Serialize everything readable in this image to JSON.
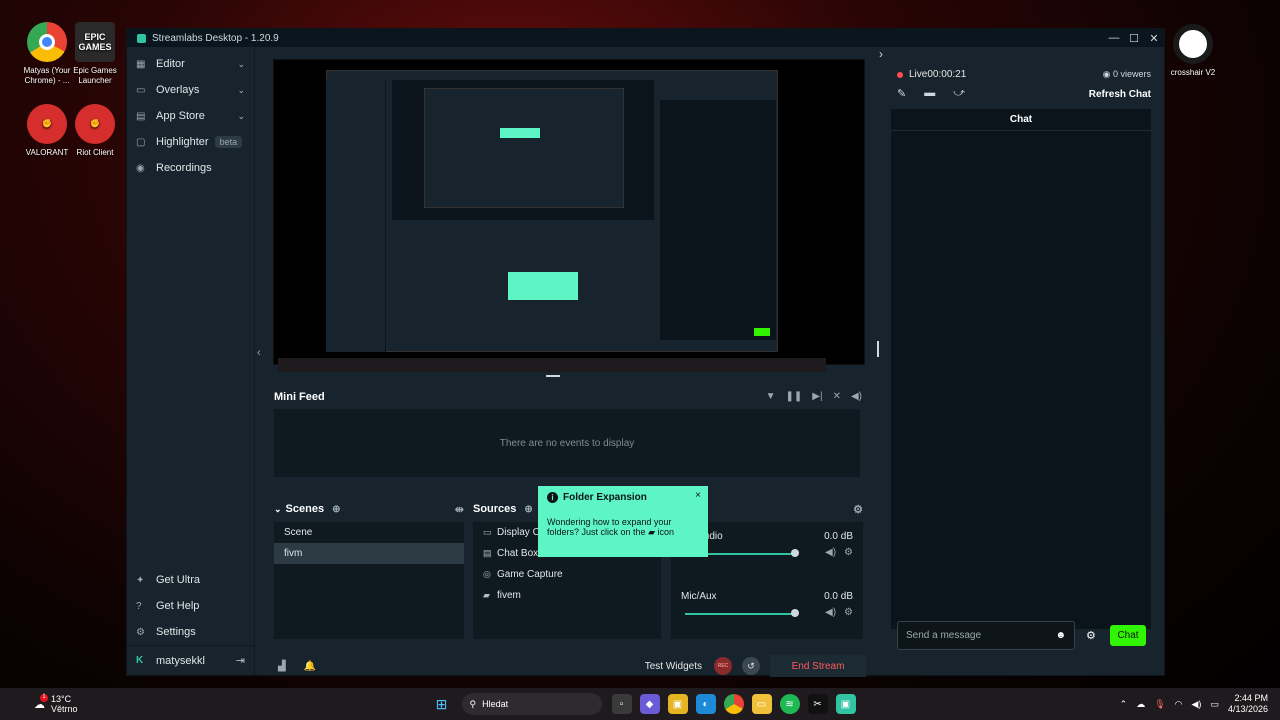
{
  "desktop": {
    "icons": [
      {
        "label": "Matyas (Your Chrome) - ...",
        "color": "#e8453c"
      },
      {
        "label": "Epic Games Launcher",
        "color": "#2a2a2a",
        "badge": "EPIC GAMES"
      },
      {
        "label": "VALORANT",
        "color": "#d62d2d"
      },
      {
        "label": "Riot Client",
        "color": "#d62d2d"
      },
      {
        "label": "crosshair V2",
        "color": "#1a1a1a"
      }
    ]
  },
  "window": {
    "title": "Streamlabs Desktop - 1.20.9",
    "ctrls": [
      "—",
      "☐",
      "✕"
    ]
  },
  "sidebar": {
    "items": [
      {
        "label": "Editor",
        "icon": "layout-icon",
        "glyph": "▦"
      },
      {
        "label": "Overlays",
        "icon": "overlays-icon",
        "glyph": "▭"
      },
      {
        "label": "App Store",
        "icon": "store-icon",
        "glyph": "▤"
      },
      {
        "label": "Highlighter",
        "icon": "highlighter-icon",
        "glyph": "▢",
        "badge": "beta"
      },
      {
        "label": "Recordings",
        "icon": "recordings-icon",
        "glyph": "◉"
      }
    ],
    "bottom": [
      {
        "label": "Get Ultra",
        "icon": "ultra-icon",
        "glyph": "✦"
      },
      {
        "label": "Get Help",
        "icon": "help-icon",
        "glyph": "?"
      },
      {
        "label": "Settings",
        "icon": "gear-icon",
        "glyph": "⚙"
      }
    ],
    "user": "matysekkl"
  },
  "minifeed": {
    "title": "Mini Feed",
    "empty_text": "There are no events to display"
  },
  "scenes": {
    "title": "Scenes",
    "items": [
      "Scene",
      "fivm"
    ]
  },
  "sources": {
    "title": "Sources",
    "items": [
      {
        "label": "Display Ca",
        "glyph": "▭"
      },
      {
        "label": "Chat Box",
        "glyph": "▤"
      },
      {
        "label": "Game Capture",
        "glyph": "◎"
      },
      {
        "label": "fivem",
        "glyph": "▰"
      }
    ]
  },
  "mixer": {
    "channels": [
      {
        "name": "top Audio",
        "value": "0.0 dB"
      },
      {
        "name": "Mic/Aux",
        "value": "0.0 dB"
      }
    ]
  },
  "tooltip": {
    "title": "Folder Expansion",
    "body_1": "Wondering how to expand your",
    "body_2": "folders? Just click on the",
    "body_3": "icon",
    "close": "×"
  },
  "controls": {
    "test_widgets": "Test Widgets",
    "rec": "REC",
    "end_stream": "End Stream"
  },
  "stream": {
    "live_label": "Live",
    "live_time": "00:00:21",
    "viewers": "0 viewers",
    "refresh_chat": "Refresh Chat"
  },
  "chat": {
    "header": "Chat",
    "placeholder": "Send a message",
    "send": "Chat"
  },
  "taskbar": {
    "weather_temp": "13°C",
    "weather_desc": "Větrno",
    "search": "Hledat",
    "time": "2:44 PM",
    "date": "4/13/2026",
    "notif_count": "1"
  },
  "colors": {
    "accent": "#31c3a2",
    "live_red": "#ff4d4d",
    "end_stream": "#ff5b5b",
    "chat_green": "#31f500",
    "tooltip": "#5ef5c5"
  }
}
